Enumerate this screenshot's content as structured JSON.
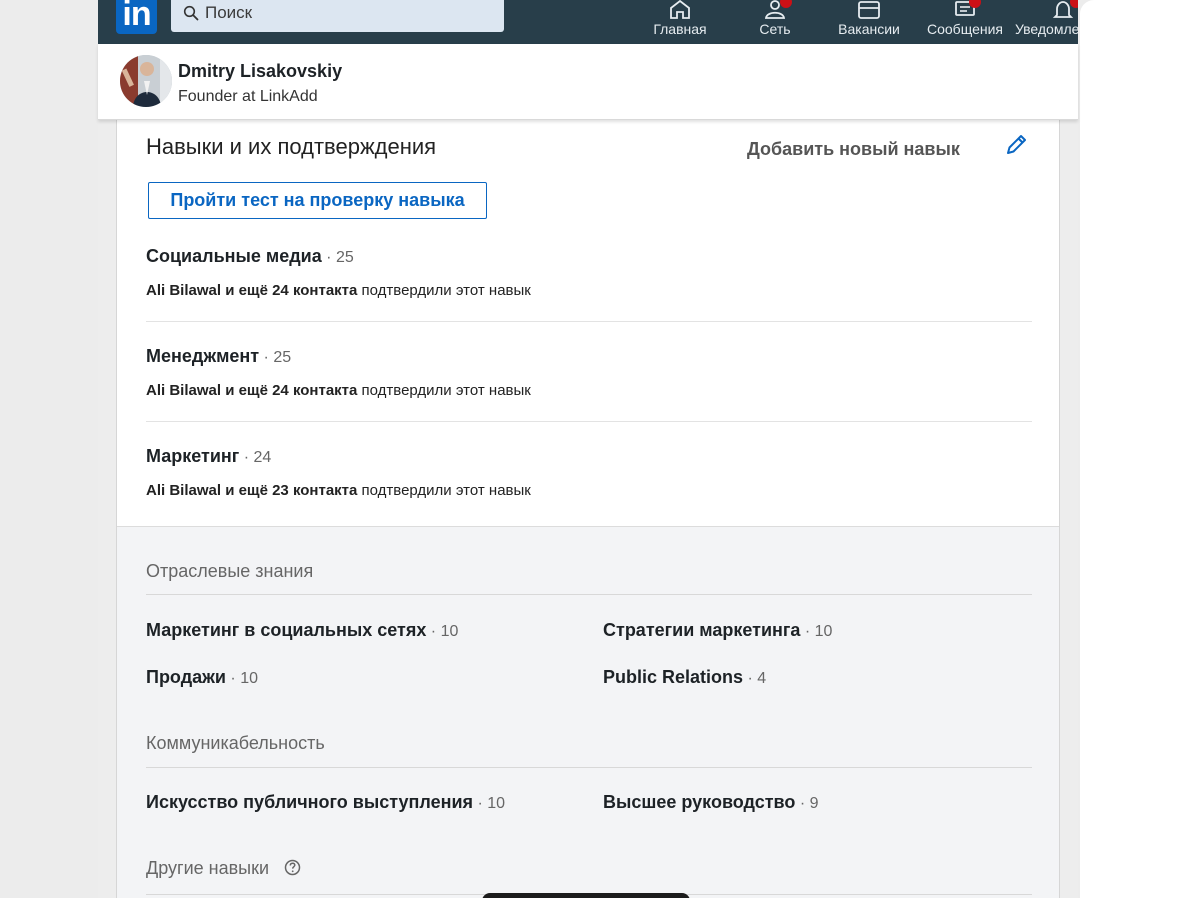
{
  "colors": {
    "navbar_bg": "#283e4a",
    "brand_blue": "#0a66c2",
    "badge_red": "#cc1016"
  },
  "navbar": {
    "logo_text": "in",
    "search_placeholder": "Поиск",
    "items": [
      {
        "label": "Главная",
        "icon": "home-icon",
        "badge": false
      },
      {
        "label": "Сеть",
        "icon": "network-icon",
        "badge": true
      },
      {
        "label": "Вакансии",
        "icon": "jobs-icon",
        "badge": false
      },
      {
        "label": "Сообщения",
        "icon": "messaging-icon",
        "badge": true
      },
      {
        "label": "Уведомле",
        "icon": "notifications-icon",
        "badge": true
      }
    ]
  },
  "profile": {
    "name": "Dmitry Lisakovskiy",
    "headline": "Founder at LinkAdd"
  },
  "skills_section": {
    "title": "Навыки и их подтверждения",
    "add_skill_label": "Добавить новый навык",
    "test_button_label": "Пройти тест на проверку навыка",
    "top_skills": [
      {
        "name": "Социальные медиа",
        "count": " · 25",
        "endorsers": "Ali Bilawal и ещё 24 контакта",
        "endorse_suffix": " подтвердили этот навык"
      },
      {
        "name": "Менеджмент",
        "count": " · 25",
        "endorsers": "Ali Bilawal и ещё 24 контакта",
        "endorse_suffix": " подтвердили этот навык"
      },
      {
        "name": "Маркетинг",
        "count": " · 24",
        "endorsers": "Ali Bilawal и ещё 23 контакта",
        "endorse_suffix": " подтвердили этот навык"
      }
    ],
    "categories": [
      {
        "title": "Отраслевые знания",
        "skills": [
          {
            "name": "Маркетинг в социальных сетях",
            "count": " · 10"
          },
          {
            "name": "Стратегии маркетинга",
            "count": " · 10"
          },
          {
            "name": "Продажи",
            "count": " · 10"
          },
          {
            "name": "Public Relations",
            "count": " · 4"
          }
        ]
      },
      {
        "title": "Коммуникабельность",
        "skills": [
          {
            "name": "Искусство публичного выступления",
            "count": " · 10"
          },
          {
            "name": "Высшее руководство",
            "count": " · 9"
          }
        ]
      },
      {
        "title": "Другие навыки",
        "skills": []
      }
    ]
  }
}
